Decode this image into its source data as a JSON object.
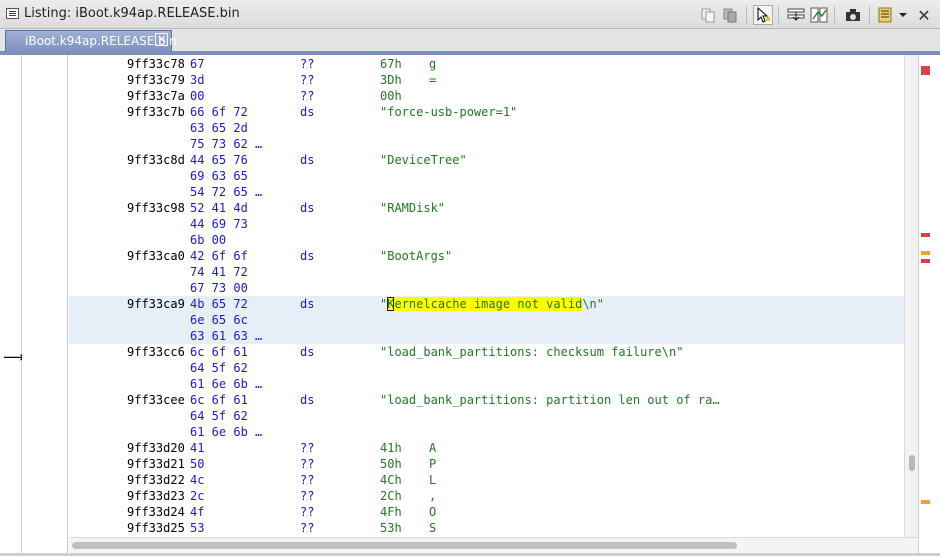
{
  "window": {
    "title": "Listing: iBoot.k94ap.RELEASE.bin",
    "tab_label": "iBoot.k94ap.RELEASE.bin",
    "tab_close": "✕",
    "close_glyph": "✕"
  },
  "toolbar": {
    "icons": [
      "copy-icon",
      "paste-icon",
      "cursor-select-icon",
      "field-nav-icon",
      "diff-icon",
      "snapshot-icon",
      "listing-fields-icon",
      "dropdown-icon",
      "close-icon"
    ]
  },
  "margin": {
    "cursor_arrow": "⟶"
  },
  "listing": {
    "rows": [
      {
        "addr": "9ff33c78",
        "bytes": "67",
        "mnem": "??",
        "val": "67h",
        "chr": "g"
      },
      {
        "addr": "9ff33c79",
        "bytes": "3d",
        "mnem": "??",
        "val": "3Dh",
        "chr": "="
      },
      {
        "addr": "9ff33c7a",
        "bytes": "00",
        "mnem": "??",
        "val": "00h",
        "chr": ""
      },
      {
        "addr": "9ff33c7b",
        "bytes": "66 6f 72",
        "mnem": "ds",
        "val": "\"force-usb-power=1\"",
        "chr": ""
      },
      {
        "addr": "",
        "bytes": "63 65 2d",
        "mnem": "",
        "val": "",
        "chr": ""
      },
      {
        "addr": "",
        "bytes": "75 73 62 …",
        "mnem": "",
        "val": "",
        "chr": ""
      },
      {
        "addr": "9ff33c8d",
        "bytes": "44 65 76",
        "mnem": "ds",
        "val": "\"DeviceTree\"",
        "chr": ""
      },
      {
        "addr": "",
        "bytes": "69 63 65",
        "mnem": "",
        "val": "",
        "chr": ""
      },
      {
        "addr": "",
        "bytes": "54 72 65 …",
        "mnem": "",
        "val": "",
        "chr": ""
      },
      {
        "addr": "9ff33c98",
        "bytes": "52 41 4d",
        "mnem": "ds",
        "val": "\"RAMDisk\"",
        "chr": ""
      },
      {
        "addr": "",
        "bytes": "44 69 73",
        "mnem": "",
        "val": "",
        "chr": ""
      },
      {
        "addr": "",
        "bytes": "6b 00",
        "mnem": "",
        "val": "",
        "chr": ""
      },
      {
        "addr": "9ff33ca0",
        "bytes": "42 6f 6f",
        "mnem": "ds",
        "val": "\"BootArgs\"",
        "chr": ""
      },
      {
        "addr": "",
        "bytes": "74 41 72",
        "mnem": "",
        "val": "",
        "chr": ""
      },
      {
        "addr": "",
        "bytes": "67 73 00",
        "mnem": "",
        "val": "",
        "chr": ""
      },
      {
        "addr": "9ff33ca9",
        "bytes": "4b 65 72",
        "mnem": "ds",
        "val": "",
        "chr": "",
        "highlight": true
      },
      {
        "addr": "",
        "bytes": "6e 65 6c",
        "mnem": "",
        "val": "",
        "chr": "",
        "highlight": true
      },
      {
        "addr": "",
        "bytes": "63 61 63 …",
        "mnem": "",
        "val": "",
        "chr": "",
        "highlight": true
      },
      {
        "addr": "9ff33cc6",
        "bytes": "6c 6f 61",
        "mnem": "ds",
        "val": "\"load_bank_partitions: checksum failure\\n\"",
        "chr": ""
      },
      {
        "addr": "",
        "bytes": "64 5f 62",
        "mnem": "",
        "val": "",
        "chr": ""
      },
      {
        "addr": "",
        "bytes": "61 6e 6b …",
        "mnem": "",
        "val": "",
        "chr": ""
      },
      {
        "addr": "9ff33cee",
        "bytes": "6c 6f 61",
        "mnem": "ds",
        "val": "\"load_bank_partitions: partition len out of ra…",
        "chr": ""
      },
      {
        "addr": "",
        "bytes": "64 5f 62",
        "mnem": "",
        "val": "",
        "chr": ""
      },
      {
        "addr": "",
        "bytes": "61 6e 6b …",
        "mnem": "",
        "val": "",
        "chr": ""
      },
      {
        "addr": "9ff33d20",
        "bytes": "41",
        "mnem": "??",
        "val": "41h",
        "chr": "A"
      },
      {
        "addr": "9ff33d21",
        "bytes": "50",
        "mnem": "??",
        "val": "50h",
        "chr": "P"
      },
      {
        "addr": "9ff33d22",
        "bytes": "4c",
        "mnem": "??",
        "val": "4Ch",
        "chr": "L"
      },
      {
        "addr": "9ff33d23",
        "bytes": "2c",
        "mnem": "??",
        "val": "2Ch",
        "chr": ","
      },
      {
        "addr": "9ff33d24",
        "bytes": "4f",
        "mnem": "??",
        "val": "4Fh",
        "chr": "O"
      },
      {
        "addr": "9ff33d25",
        "bytes": "53",
        "mnem": "??",
        "val": "53h",
        "chr": "S"
      }
    ],
    "highlight_value": {
      "quote_open": "\"",
      "first_char": "K",
      "highlighted": "ernelcache image not valid",
      "rest": "\\n\""
    }
  }
}
